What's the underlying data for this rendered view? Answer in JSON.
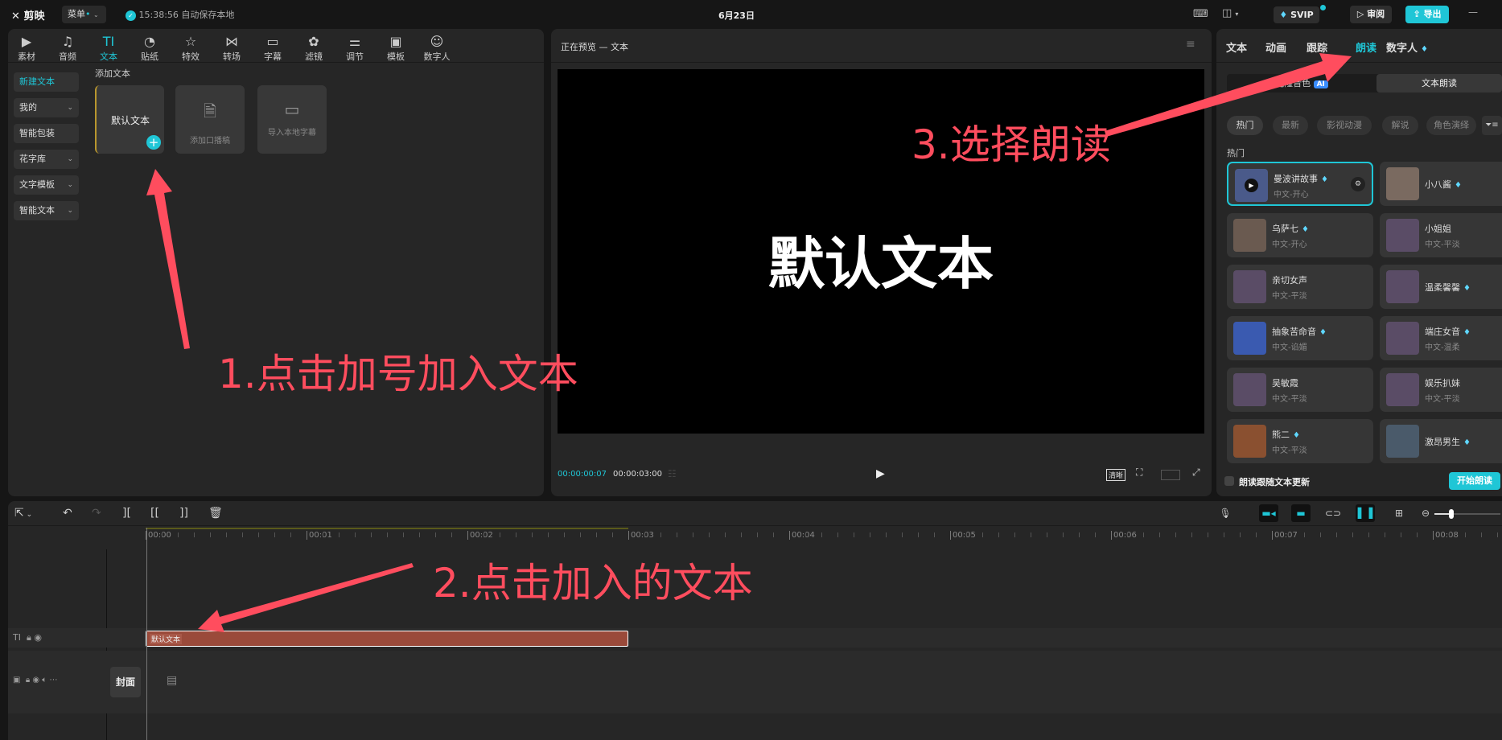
{
  "app": {
    "logo": "剪映",
    "menu": "菜单",
    "save_status": "15:38:56 自动保存本地",
    "title": "6月23日",
    "svip": "SVIP",
    "review": "审阅",
    "export": "导出"
  },
  "media_tabs": [
    {
      "label": "素材",
      "icon": "▶"
    },
    {
      "label": "音频",
      "icon": "♫"
    },
    {
      "label": "文本",
      "icon": "TI"
    },
    {
      "label": "贴纸",
      "icon": "◔"
    },
    {
      "label": "特效",
      "icon": "☆"
    },
    {
      "label": "转场",
      "icon": "⋈"
    },
    {
      "label": "字幕",
      "icon": "▭"
    },
    {
      "label": "滤镜",
      "icon": "✿"
    },
    {
      "label": "调节",
      "icon": "⚌"
    },
    {
      "label": "模板",
      "icon": "▣"
    },
    {
      "label": "数字人",
      "icon": "☺"
    }
  ],
  "sidebar": [
    {
      "label": "新建文本",
      "active": true
    },
    {
      "label": "我的",
      "chev": true
    },
    {
      "label": "智能包装"
    },
    {
      "label": "花字库",
      "chev": true
    },
    {
      "label": "文字模板",
      "chev": true
    },
    {
      "label": "智能文本",
      "chev": true
    }
  ],
  "text_panel": {
    "section": "添加文本",
    "default_text": "默认文本",
    "add_script": "添加口播稿",
    "import_subs": "导入本地字幕"
  },
  "preview": {
    "title": "正在预览 — 文本",
    "canvas_text": "默认文本",
    "current_time": "00:00:00:07",
    "total_time": "00:00:03:00",
    "quality": "清晰"
  },
  "right": {
    "tabs": [
      "文本",
      "动画",
      "跟踪",
      "朗读",
      "数字人"
    ],
    "active_tab": "朗读",
    "segments": [
      "克隆音色",
      "文本朗读"
    ],
    "ai_badge": "AI",
    "chips": [
      "热门",
      "最新",
      "影视动漫",
      "解说",
      "角色演绎"
    ],
    "section": "热门",
    "voices": [
      {
        "name": "曼波讲故事",
        "sub": "中文-开心",
        "vip": true,
        "selected": true,
        "color": "#4a5a8a"
      },
      {
        "name": "小八酱",
        "sub": "",
        "vip": true,
        "color": "#7a6a60"
      },
      {
        "name": "乌萨七",
        "sub": "中文-开心",
        "vip": true,
        "color": "#6a5a50"
      },
      {
        "name": "小姐姐",
        "sub": "中文-平淡",
        "vip": false,
        "color": "#5a4c66"
      },
      {
        "name": "亲切女声",
        "sub": "中文-平淡",
        "vip": false,
        "color": "#5a4c66"
      },
      {
        "name": "温柔馨馨",
        "sub": "",
        "vip": true,
        "color": "#5a4c66"
      },
      {
        "name": "抽象苦命音",
        "sub": "中文-谄媚",
        "vip": true,
        "color": "#3a5ab0"
      },
      {
        "name": "端庄女音",
        "sub": "中文-温柔",
        "vip": true,
        "color": "#5a4c66"
      },
      {
        "name": "吴敏霞",
        "sub": "中文-平淡",
        "vip": false,
        "color": "#5a4c66"
      },
      {
        "name": "娱乐扒妹",
        "sub": "中文-平淡",
        "vip": false,
        "color": "#5a4c66"
      },
      {
        "name": "熊二",
        "sub": "中文-平淡",
        "vip": true,
        "color": "#8a5030"
      },
      {
        "name": "激昂男生",
        "sub": "",
        "vip": true,
        "color": "#4a5a6a"
      }
    ],
    "follow_update": "朗读跟随文本更新",
    "start": "开始朗读"
  },
  "timeline": {
    "ticks": [
      "00:00",
      "00:01",
      "00:02",
      "00:03",
      "00:04",
      "00:05",
      "00:06",
      "00:07",
      "00:08"
    ],
    "clip_label": "默认文本",
    "clip_seconds": 3,
    "cover": "封面"
  },
  "annotations": {
    "step1": "1.点击加号加入文本",
    "step2": "2.点击加入的文本",
    "step3": "3.选择朗读"
  },
  "colors": {
    "accent": "#1fc6d6",
    "annotation": "#ff4d5e",
    "clip": "#9a4a3a"
  }
}
